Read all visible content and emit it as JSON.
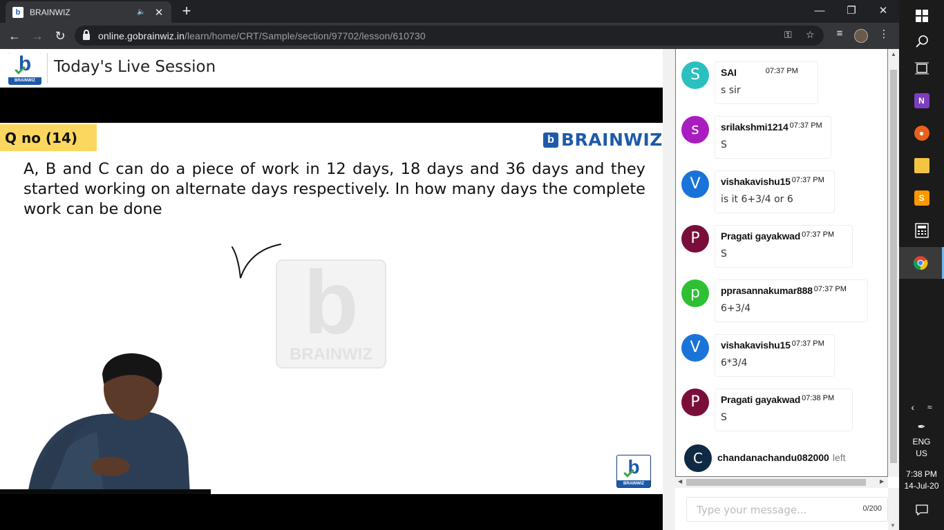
{
  "browser": {
    "tab_title": "BRAINWIZ",
    "url_host": "online.gobrainwiz.in",
    "url_path": "/learn/home/CRT/Sample/section/97702/lesson/610730"
  },
  "header": {
    "logo_text": "BRAINWIZ",
    "title": "Today's Live Session"
  },
  "slide": {
    "qno": "Q no (14)",
    "brand": "BRAINWIZ",
    "question": "A, B and C can do a piece of work in 12 days, 18 days and 36 days and they started working on alternate days respectively. In how many days the complete work can be done",
    "watermark": "BRAINWIZ"
  },
  "chat": {
    "messages": [
      {
        "avatar": "S",
        "color": "#2bc0c0",
        "name": "SAI",
        "time": "07:37 PM",
        "text": "s sir"
      },
      {
        "avatar": "s",
        "color": "#a91cc0",
        "name": "srilakshmi1214",
        "time": "07:37 PM",
        "text": "S"
      },
      {
        "avatar": "V",
        "color": "#1a73d9",
        "name": "vishakavishu15",
        "time": "07:37 PM",
        "text": "is it 6+3/4 or 6"
      },
      {
        "avatar": "P",
        "color": "#7a0e3a",
        "name": "Pragati gayakwad",
        "time": "07:37 PM",
        "text": "S"
      },
      {
        "avatar": "p",
        "color": "#2ec032",
        "name": "pprasannakumar888",
        "time": "07:37 PM",
        "text": "6+3/4"
      },
      {
        "avatar": "V",
        "color": "#1a73d9",
        "name": "vishakavishu15",
        "time": "07:37 PM",
        "text": "6*3/4"
      },
      {
        "avatar": "P",
        "color": "#7a0e3a",
        "name": "Pragati gayakwad",
        "time": "07:38 PM",
        "text": "S"
      }
    ],
    "left_event": {
      "avatar": "C",
      "name": "chandanachandu082000",
      "word": "left"
    },
    "input_placeholder": "Type your message...",
    "char_count": "0/200"
  },
  "taskbar": {
    "lang_1": "ENG",
    "lang_2": "US",
    "time": "7:38 PM",
    "date": "14-Jul-20"
  }
}
